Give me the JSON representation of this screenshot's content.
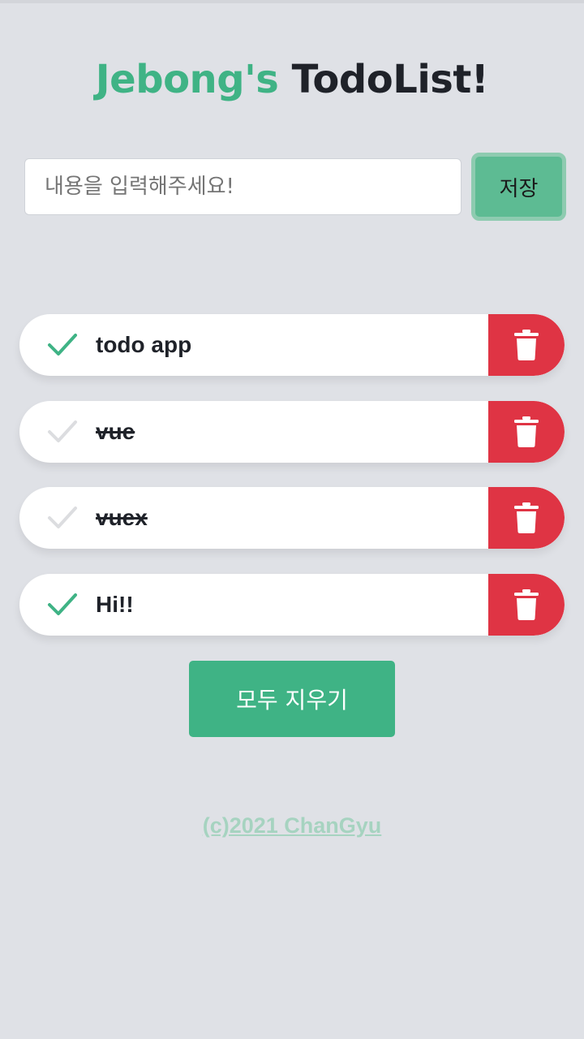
{
  "header": {
    "title_accent": "Jebong's",
    "title_rest": "TodoList!"
  },
  "input": {
    "placeholder": "내용을 입력해주세요!",
    "value": ""
  },
  "save_button": {
    "label": "저장"
  },
  "todos": [
    {
      "text": "todo app",
      "completed": false
    },
    {
      "text": "vue",
      "completed": true
    },
    {
      "text": "vuex",
      "completed": true
    },
    {
      "text": "Hi!!",
      "completed": false
    }
  ],
  "clear_button": {
    "label": "모두 지우기"
  },
  "footer": {
    "text": "(c)2021 ChanGyu"
  },
  "colors": {
    "accent": "#3fb385",
    "delete": "#df3444",
    "background": "#dfe1e6"
  },
  "icons": {
    "check": "check-icon",
    "delete": "trash-icon"
  }
}
